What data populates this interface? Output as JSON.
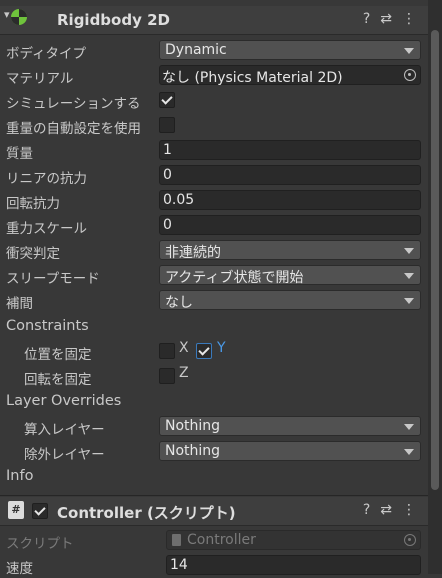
{
  "rigidbody": {
    "title": "Rigidbody 2D",
    "body_type": {
      "label": "ボディタイプ",
      "value": "Dynamic"
    },
    "material": {
      "label": "マテリアル",
      "value": "なし (Physics Material 2D)"
    },
    "simulated": {
      "label": "シミュレーションする",
      "checked": true
    },
    "auto_mass": {
      "label": "重量の自動設定を使用",
      "checked": false
    },
    "mass": {
      "label": "質量",
      "value": "1"
    },
    "linear_drag": {
      "label": "リニアの抗力",
      "value": "0"
    },
    "angular_drag": {
      "label": "回転抗力",
      "value": "0.05"
    },
    "gravity_scale": {
      "label": "重力スケール",
      "value": "0"
    },
    "collision_detection": {
      "label": "衝突判定",
      "value": "非連続的"
    },
    "sleeping_mode": {
      "label": "スリープモード",
      "value": "アクティブ状態で開始"
    },
    "interpolate": {
      "label": "補間",
      "value": "なし"
    },
    "constraints": {
      "label": "Constraints",
      "freeze_position": {
        "label": "位置を固定",
        "x": "X",
        "y": "Y",
        "x_checked": false,
        "y_checked": true
      },
      "freeze_rotation": {
        "label": "回転を固定",
        "z": "Z",
        "z_checked": false
      }
    },
    "layer_overrides": {
      "label": "Layer Overrides",
      "include": {
        "label": "算入レイヤー",
        "value": "Nothing"
      },
      "exclude": {
        "label": "除外レイヤー",
        "value": "Nothing"
      }
    },
    "info": {
      "label": "Info"
    }
  },
  "controller": {
    "title": "Controller (スクリプト)",
    "script": {
      "label": "スクリプト",
      "value": "Controller"
    },
    "speed": {
      "label": "速度",
      "value": "14"
    }
  },
  "icons": {
    "help": "?",
    "presets": "⇄",
    "more": "⋮",
    "script_hash": "#"
  },
  "colors": {
    "accent_blue": "#4a9ae8",
    "rigidbody_icon": "#6fc33c"
  }
}
